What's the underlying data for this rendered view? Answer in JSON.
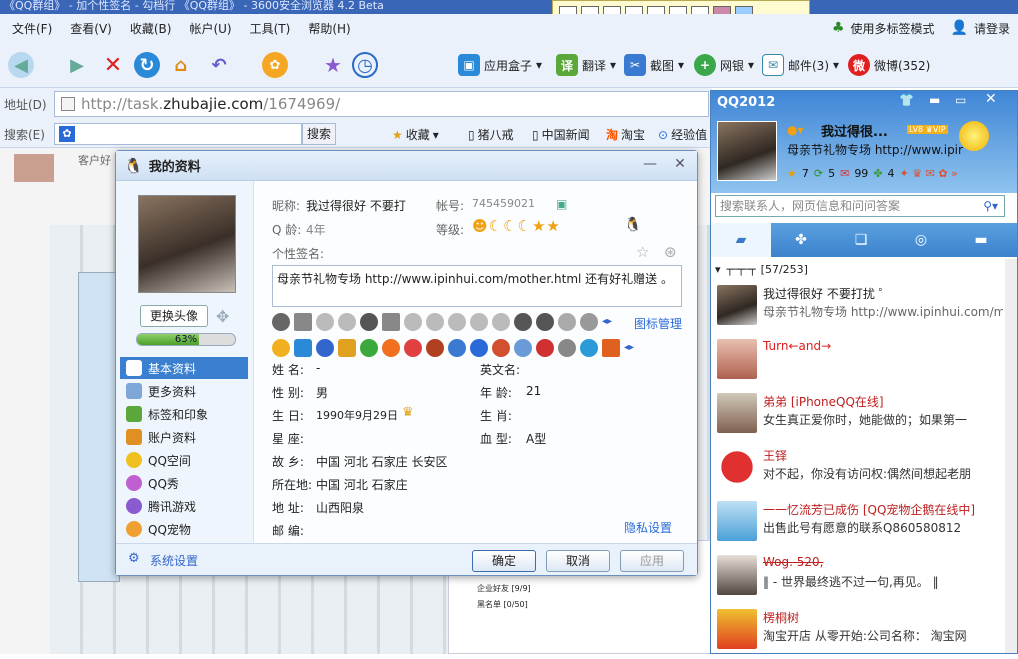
{
  "browser": {
    "title": "《QQ群组》 - 加个性签名 - 勾档行 《QQ群组》 - 3600安全浏览器 4.2 Beta",
    "menus": [
      "文件(F)",
      "查看(V)",
      "收藏(B)",
      "帐户(U)",
      "工具(T)",
      "帮助(H)"
    ],
    "right_menu": [
      "使用多标签模式",
      "请登录"
    ],
    "tools": [
      "应用盒子",
      "翻译",
      "截图",
      "网银",
      "邮件(3)",
      "微博(352)"
    ],
    "address_label": "地址(D)",
    "url_prefix": "http://task.",
    "url_domain": "zhubajie.com",
    "url_path": "/1674969/",
    "search_label": "搜索(E)",
    "search_button": "搜索",
    "favorites": [
      "收藏",
      "猪八戒",
      "中国新闻",
      "淘宝",
      "经验值"
    ],
    "page_snippet": "客户好"
  },
  "dialog": {
    "title": "我的资料",
    "change_avatar": "更换头像",
    "progress": "63%",
    "progress_value": 0.63,
    "nav": [
      "基本资料",
      "更多资料",
      "标签和印象",
      "账户资料",
      "QQ空间",
      "QQ秀",
      "腾讯游戏",
      "QQ宠物"
    ],
    "system_settings": "系统设置",
    "nickname_label": "昵称:",
    "nickname": "我过得很好 不要打",
    "account_label": "帐号:",
    "account": "745459021",
    "age_label": "Q 龄:",
    "age": "4年",
    "level_label": "等级:",
    "signature_label": "个性签名:",
    "signature": "母亲节礼物专场 http://www.ipinhui.com/mother.html 还有好礼赠送 。",
    "icon_manage": "图标管理",
    "fields": [
      {
        "label": "姓    名:",
        "value": "-"
      },
      {
        "label": "性    别:",
        "value": "男"
      },
      {
        "label": "生    日:",
        "value": "1990年9月29日"
      },
      {
        "label": "星    座:",
        "value": ""
      },
      {
        "label": "故    乡:",
        "value": "中国  河北  石家庄  长安区"
      },
      {
        "label": "所在地:",
        "value": "中国  河北  石家庄"
      },
      {
        "label": "地    址:",
        "value": "山西阳泉"
      },
      {
        "label": "邮    编:",
        "value": ""
      }
    ],
    "fields_right": [
      {
        "label": "英文名:",
        "value": ""
      },
      {
        "label": "年    龄:",
        "value": "21"
      },
      {
        "label": "生    肖:",
        "value": ""
      },
      {
        "label": "血    型:",
        "value": "A型"
      }
    ],
    "privacy": "隐私设置",
    "ok": "确定",
    "cancel": "取消",
    "apply": "应用"
  },
  "qq": {
    "title": "QQ2012",
    "nickname": "我过得很...",
    "signature": "母亲节礼物专场 http://www.ipir",
    "badges": [
      "7",
      "5",
      "99",
      "4"
    ],
    "search_placeholder": "搜索联系人，网页信息和问问答案",
    "group_name": "[57/253]",
    "contacts": [
      {
        "name": "我过得很好 不要打扰 ゜",
        "status": "母亲节礼物专场 http://www.ipinhui.com/mot",
        "color": "#2a2a2a"
      },
      {
        "name": "Turn←and→",
        "status": "",
        "color": "#e02020"
      },
      {
        "name": "弟弟 [iPhoneQQ在线]",
        "status": "女生真正爱你时，她能做的；如果第一",
        "color": "#c02020"
      },
      {
        "name": "王铎",
        "status": "对不起，你没有访问权:偶然间想起老朋",
        "color": "#c02020"
      },
      {
        "name": "一一忆流芳已成伤 [QQ宠物企鹅在线中]",
        "status": "出售此号有愿意的联系Q860580812",
        "color": "#c02020"
      },
      {
        "name": "Wog.     520,",
        "status": "‖ - 世界最终逃不过一句,再见。 ‖",
        "color": "#c02020"
      },
      {
        "name": "楞桐树",
        "status": "淘宝开店 从零开始:公司名称： 淘宝网",
        "color": "#c02020"
      }
    ]
  },
  "background_card": {
    "rows": [
      "企业好友 [9/9]",
      "黑名单 [0/50]"
    ]
  }
}
